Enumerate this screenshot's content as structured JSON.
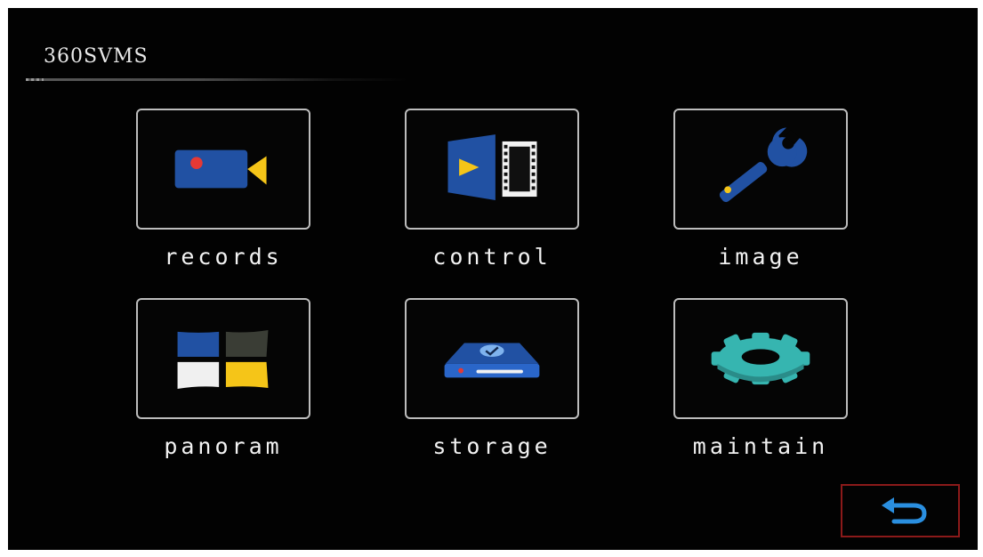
{
  "header": {
    "title": "360SVMS"
  },
  "menu": {
    "items": [
      {
        "label": "records",
        "icon": "video-camera-icon"
      },
      {
        "label": "control",
        "icon": "play-film-icon"
      },
      {
        "label": "image",
        "icon": "wrench-icon"
      },
      {
        "label": "panoram",
        "icon": "panorama-quad-icon"
      },
      {
        "label": "storage",
        "icon": "hard-drive-icon"
      },
      {
        "label": "maintain",
        "icon": "gear-icon"
      }
    ]
  },
  "footer": {
    "back_icon": "return-arrow-icon"
  },
  "colors": {
    "background": "#020202",
    "tile_border": "#bdbdbd",
    "icon_blue": "#2151a3",
    "icon_yellow": "#f5c518",
    "icon_red": "#e53935",
    "gear_teal": "#36b5b0",
    "back_border": "#8b1a1a",
    "back_arrow": "#2a8fe0"
  }
}
